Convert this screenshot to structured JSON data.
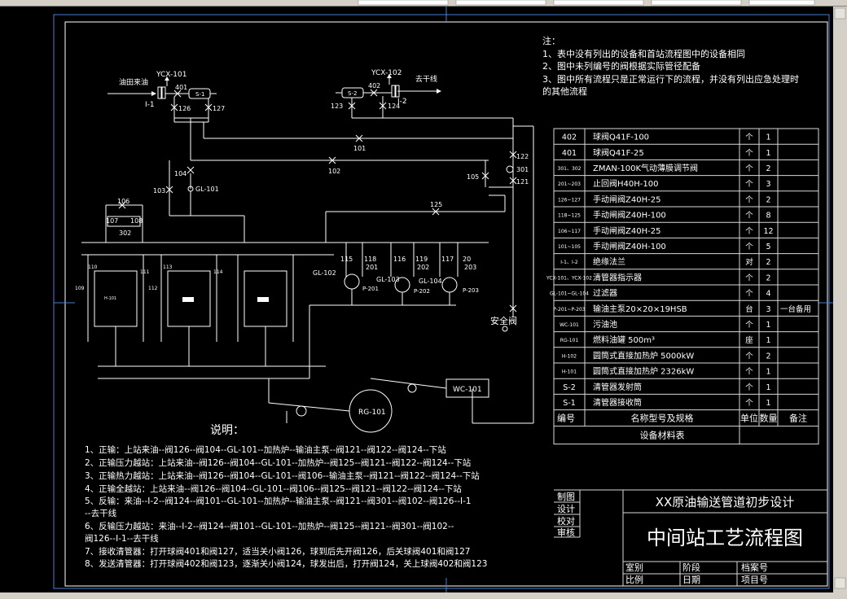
{
  "toolbar": {
    "top_strip": ""
  },
  "notes": {
    "title": "注：",
    "lines": [
      "1、表中没有列出的设备和首站流程图中的设备相同",
      "2、图中未列编号的阀根据实际管径配备",
      "3、图中所有流程只是正常运行下的流程，并没有列出应急处理时",
      "的其他流程"
    ]
  },
  "equipment_table": {
    "rows": [
      {
        "code": "402",
        "name": "球阀Q41F-100",
        "unit": "个",
        "qty": "1",
        "remark": ""
      },
      {
        "code": "401",
        "name": "球阀Q41F-25",
        "unit": "个",
        "qty": "1",
        "remark": ""
      },
      {
        "code": "301、302",
        "name": "ZMAN-100K气动薄膜调节阀",
        "unit": "个",
        "qty": "2",
        "remark": ""
      },
      {
        "code": "201~203",
        "name": "止回阀H40H-100",
        "unit": "个",
        "qty": "3",
        "remark": ""
      },
      {
        "code": "126~127",
        "name": "手动闸阀Z40H-25",
        "unit": "个",
        "qty": "2",
        "remark": ""
      },
      {
        "code": "118~125",
        "name": "手动闸阀Z40H-100",
        "unit": "个",
        "qty": "8",
        "remark": ""
      },
      {
        "code": "106~117",
        "name": "手动闸阀Z40H-25",
        "unit": "个",
        "qty": "12",
        "remark": ""
      },
      {
        "code": "101~105",
        "name": "手动闸阀Z40H-100",
        "unit": "个",
        "qty": "5",
        "remark": ""
      },
      {
        "code": "I-1、I-2",
        "name": "绝缘法兰",
        "unit": "对",
        "qty": "2",
        "remark": ""
      },
      {
        "code": "YCX-101、YCX-102",
        "name": "清管器指示器",
        "unit": "个",
        "qty": "2",
        "remark": ""
      },
      {
        "code": "GL-101~GL-104",
        "name": "过滤器",
        "unit": "个",
        "qty": "4",
        "remark": ""
      },
      {
        "code": "P-201~P-203",
        "name": "输油主泵20×20×19HSB",
        "unit": "台",
        "qty": "3",
        "remark": "一台备用"
      },
      {
        "code": "WC-101",
        "name": "污油池",
        "unit": "个",
        "qty": "1",
        "remark": ""
      },
      {
        "code": "RG-101",
        "name": "燃料油罐    500m³",
        "unit": "座",
        "qty": "1",
        "remark": ""
      },
      {
        "code": "H-102",
        "name": "圆筒式直接加热炉    5000kW",
        "unit": "个",
        "qty": "2",
        "remark": ""
      },
      {
        "code": "H-101",
        "name": "圆筒式直接加热炉    2326kW",
        "unit": "个",
        "qty": "1",
        "remark": ""
      },
      {
        "code": "S-2",
        "name": "清管器发射筒",
        "unit": "个",
        "qty": "1",
        "remark": ""
      },
      {
        "code": "S-1",
        "name": "清管器接收筒",
        "unit": "个",
        "qty": "1",
        "remark": ""
      }
    ],
    "header": {
      "code": "编号",
      "name": "名称型号及规格",
      "unit": "单位",
      "qty": "数量",
      "remark": "备注"
    },
    "caption": "设备材料表"
  },
  "title_block": {
    "project": "XX原油输送管道初步设计",
    "drawing": "中间站工艺流程图",
    "left_labels": [
      "制图",
      "设计",
      "校对",
      "审核"
    ],
    "bottom_labels": [
      "室别",
      "阶段",
      "档案号",
      "比例",
      "日期",
      "项目号"
    ]
  },
  "explanation": {
    "title": "说明：",
    "lines": [
      "1、正输：上站来油--阀126--阀104--GL-101--加热炉--输油主泵--阀121--阀122--阀124--下站",
      "2、正输压力越站：上站来油--阀126--阀104--GL-101--加热炉--阀125--阀121--阀122--阀124--下站",
      "3、正输热力越站：上站来油--阀126--阀104--GL-101--阀106--输油主泵--阀121--阀122--阀124--下站",
      "4、正输全越站：上站来油--阀126--阀104--GL-101--阀106--阀125--阀121--阀122--阀124--下站",
      "5、反输：来油--I-2--阀124--阀101--GL-101--加热炉--输油主泵--阀121--阀301--阀102--阀126--I-1",
      "   --去干线",
      "6、反输压力越站：来油--I-2--阀124--阀101--GL-101--加热炉--阀125--阀121--阀301--阀102--",
      "   阀126--I-1--去干线",
      "7、接收清管器：打开球阀401和阀127，适当关小阀126，球到后先开阀126，后关球阀401和阀127",
      "8、发送清管器：打开球阀402和阀123，逐渐关小阀124，球发出后，打开阀124，关上球阀402和阀123"
    ]
  },
  "diagram_labels": {
    "ycx101": "YCX-101",
    "ycx102": "YCX-102",
    "oilfield_in": "油田来油",
    "to_trunk": "去干线",
    "i1": "I-1",
    "i2": "I-2",
    "s1": "S-1",
    "s2": "S-2",
    "v401": "401",
    "v402": "402",
    "v126": "126",
    "v127": "127",
    "v123": "123",
    "v124": "124",
    "v101": "101",
    "v102": "102",
    "v103": "103",
    "v104": "104",
    "v105": "105",
    "v106": "106",
    "v107": "107",
    "v108": "108",
    "v302": "302",
    "v301": "301",
    "v121": "121",
    "v122": "122",
    "v125": "125",
    "gl101": "GL-101",
    "gl102": "GL-102",
    "gl103": "GL-103",
    "gl104": "GL-104",
    "v115": "115",
    "v116": "116",
    "v117": "117",
    "v118": "118",
    "v119": "119",
    "v120": "20",
    "v201": "201",
    "v202": "202",
    "v203": "203",
    "p201": "P-201",
    "p202": "P-202",
    "p203": "P-203",
    "v109": "109",
    "v110": "110",
    "v111": "111",
    "v112": "112",
    "v113": "113",
    "v114": "114",
    "h101_tag": "H-101",
    "safety_valve": "安全阀",
    "wc101": "WC-101",
    "rg101": "RG-101"
  },
  "colors": {
    "background": "#000000",
    "line": "#ffffff",
    "frame": "#4a7fd0"
  }
}
